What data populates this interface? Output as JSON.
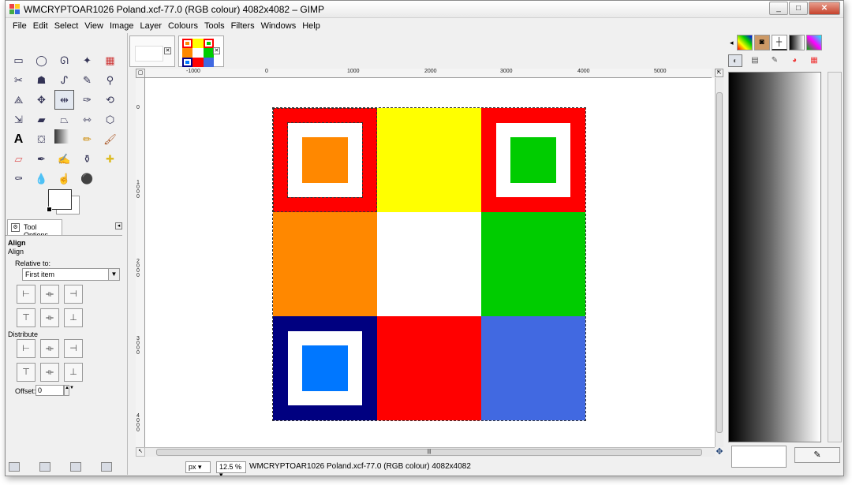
{
  "window": {
    "title": "WMCRYPTOAR1026 Poland.xcf-77.0 (RGB colour) 4082x4082 – GIMP",
    "minimize": "_",
    "maximize": "□",
    "close": "✕"
  },
  "menu": [
    "File",
    "Edit",
    "Select",
    "View",
    "Image",
    "Layer",
    "Colours",
    "Tools",
    "Filters",
    "Windows",
    "Help"
  ],
  "tools": [
    "rect-select",
    "ellipse-select",
    "free-select",
    "fuzzy-select",
    "select-by-color",
    "scissors-select",
    "foreground-select",
    "paths",
    "color-picker",
    "zoom",
    "measure",
    "move",
    "align",
    "crop",
    "rotate",
    "scale",
    "shear",
    "perspective",
    "flip",
    "cage-transform",
    "text",
    "bucket-fill",
    "blend",
    "pencil",
    "paintbrush",
    "eraser",
    "airbrush",
    "ink",
    "clone",
    "heal",
    "perspective-clone",
    "blur",
    "smudge",
    "dodge-burn",
    ""
  ],
  "tool_options": {
    "tab_label": "Tool Options",
    "title": "Align",
    "subtitle": "Align",
    "relative_label": "Relative to:",
    "relative_value": "First item",
    "distribute_label": "Distribute",
    "offset_label": "Offset:",
    "offset_value": "0"
  },
  "ruler": {
    "h_labels": [
      "-1000",
      "0",
      "1000",
      "2000",
      "3000",
      "4000",
      "5000"
    ],
    "v_labels": [
      "0",
      "1000",
      "2000",
      "3000",
      "4000"
    ]
  },
  "image": {
    "cells": [
      {
        "bg": "#ff0000",
        "inner_white": true,
        "inner": "#ff8800"
      },
      {
        "bg": "#ffff00"
      },
      {
        "bg": "#ff0000",
        "inner_white": true,
        "inner": "#00cc00"
      },
      {
        "bg": "#ff8800"
      },
      {
        "bg": "#ffffff"
      },
      {
        "bg": "#00cc00"
      },
      {
        "bg": "#000080",
        "inner_white": true,
        "inner": "#0077ff"
      },
      {
        "bg": "#ff0000"
      },
      {
        "bg": "#4169e1"
      }
    ]
  },
  "status": {
    "unit": "px",
    "zoom": "12.5 %",
    "text": "WMCRYPTOAR1026 Poland.xcf-77.0 (RGB colour) 4082x4082"
  },
  "colors": {
    "red": "#ff0000",
    "yellow": "#ffff00",
    "orange": "#ff8800",
    "green": "#00cc00",
    "navy": "#000080",
    "blue": "#0077ff",
    "royal": "#4169e1"
  }
}
